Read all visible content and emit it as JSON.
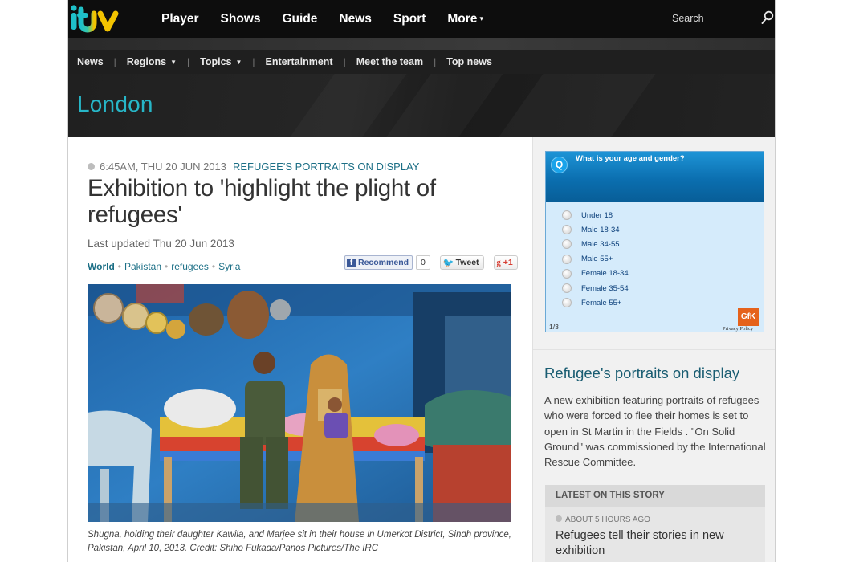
{
  "nav": {
    "items": [
      "Player",
      "Shows",
      "Guide",
      "News",
      "Sport",
      "More"
    ],
    "more_caret": "▾",
    "search_placeholder": "Search"
  },
  "subnav": {
    "items": [
      "News",
      "Regions",
      "Topics",
      "Entertainment",
      "Meet the team",
      "Top news"
    ],
    "separator": "|",
    "caret": "▼"
  },
  "region": {
    "title": "London"
  },
  "article": {
    "timestamp": "6:45AM, THU 20 JUN 2013",
    "story_label": "REFUGEE'S PORTRAITS ON DISPLAY",
    "headline": "Exhibition to 'highlight the plight of refugees'",
    "updated": "Last updated Thu 20 Jun 2013",
    "tags": [
      "World",
      "Pakistan",
      "refugees",
      "Syria"
    ],
    "tag_separator": "•",
    "social": {
      "recommend_label": "Recommend",
      "recommend_count": "0",
      "tweet_label": "Tweet",
      "gplus_label": "+1",
      "fb_glyph": "f",
      "tw_glyph": "🐦",
      "gp_glyph": "g"
    },
    "caption": "Shugna, holding their daughter Kawila, and Marjee sit in their house in Umerkot District, Sindh province, Pakistan, April 10, 2013. Credit: Shiho Fukada/Panos Pictures/The IRC"
  },
  "poll": {
    "badge": "Q",
    "question": "What is your age and gender?",
    "options": [
      "Under 18",
      "Male 18-34",
      "Male 34-55",
      "Male 55+",
      "Female 18-34",
      "Female 35-54",
      "Female 55+"
    ],
    "page": "1/3",
    "logo_text": "GfK",
    "privacy": "Privacy Policy"
  },
  "sidebar": {
    "title": "Refugee's portraits on display",
    "text": "A new exhibition featuring portraits of refugees who were forced to flee their homes is set to open in St Martin in the Fields . \"On Solid Ground\" was commissioned by the International Rescue Committee.",
    "latest_label": "LATEST ON THIS STORY",
    "latest_time": "ABOUT 5 HOURS AGO",
    "latest_title": "Refugees tell their stories in new exhibition"
  },
  "colors": {
    "itv_teal": "#27b6c7",
    "link_blue": "#1c6f86",
    "poll_blue": "#0b6fb0"
  }
}
